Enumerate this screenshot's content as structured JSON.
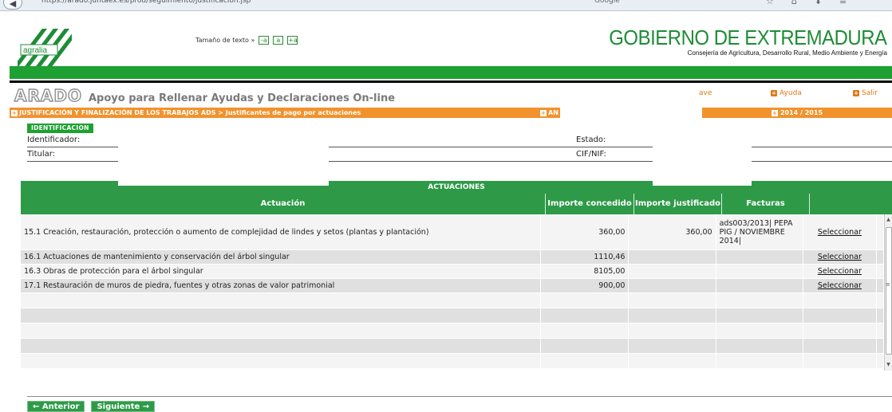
{
  "browser": {
    "url": "https://arado.juntaex.es/prod/seguimiento/justificacion.jsp",
    "search_placeholder": "Google",
    "toolbar_icons": [
      "star-icon",
      "home-icon",
      "download-icon",
      "menu-icon"
    ]
  },
  "header": {
    "logo_text": "agralia",
    "font_size_label": "Tamaño de texto »",
    "font_buttons": [
      "-a",
      "a",
      "+a"
    ],
    "gov_title": "GOBIERNO DE EXTREMADURA",
    "gov_subtitle": "Consejería de Agricultura, Desarrollo Rural, Medio Ambiente y Energía"
  },
  "app": {
    "name": "ARADO",
    "tagline": "Apoyo para Rellenar Ayudas y Declaraciones On-line",
    "link_ave": "ave",
    "link_ayuda": "Ayuda",
    "link_salir": "Salir"
  },
  "breadcrumb": {
    "text": "JUSTIFICACIÓN Y FINALIZACIÓN DE LOS TRABAJOS ADS > Justificantes de pago por actuaciones",
    "right_short": "AN",
    "campaign": "2014 / 2015"
  },
  "identification": {
    "tab": "IDENTIFICACION",
    "identificador_label": "Identificador:",
    "titular_label": "Titular:",
    "estado_label": "Estado:",
    "cif_label": "CIF/NIF:"
  },
  "table": {
    "title": "ACTUACIONES",
    "columns": [
      "Actuación",
      "Importe concedido",
      "Importe justificado",
      "Facturas"
    ],
    "select_label": "Seleccionar",
    "rows": [
      {
        "actuacion": "15.1 Creación, restauración, protección o aumento de complejidad de lindes y setos (plantas y plantación)",
        "concedido": "360,00",
        "justificado": "360,00",
        "facturas": "ads003/2013| PEPA PIG / NOVIEMBRE 2014|"
      },
      {
        "actuacion": "16.1 Actuaciones de mantenimiento y conservación del árbol singular",
        "concedido": "1110,46",
        "justificado": "",
        "facturas": ""
      },
      {
        "actuacion": "16.3 Obras de protección para el árbol singular",
        "concedido": "8105,00",
        "justificado": "",
        "facturas": ""
      },
      {
        "actuacion": "17.1 Restauración de muros de piedra, fuentes y otras zonas de valor patrimonial",
        "concedido": "900,00",
        "justificado": "",
        "facturas": ""
      }
    ]
  },
  "navigation": {
    "prev": "← Anterior",
    "next": "Siguiente →"
  }
}
